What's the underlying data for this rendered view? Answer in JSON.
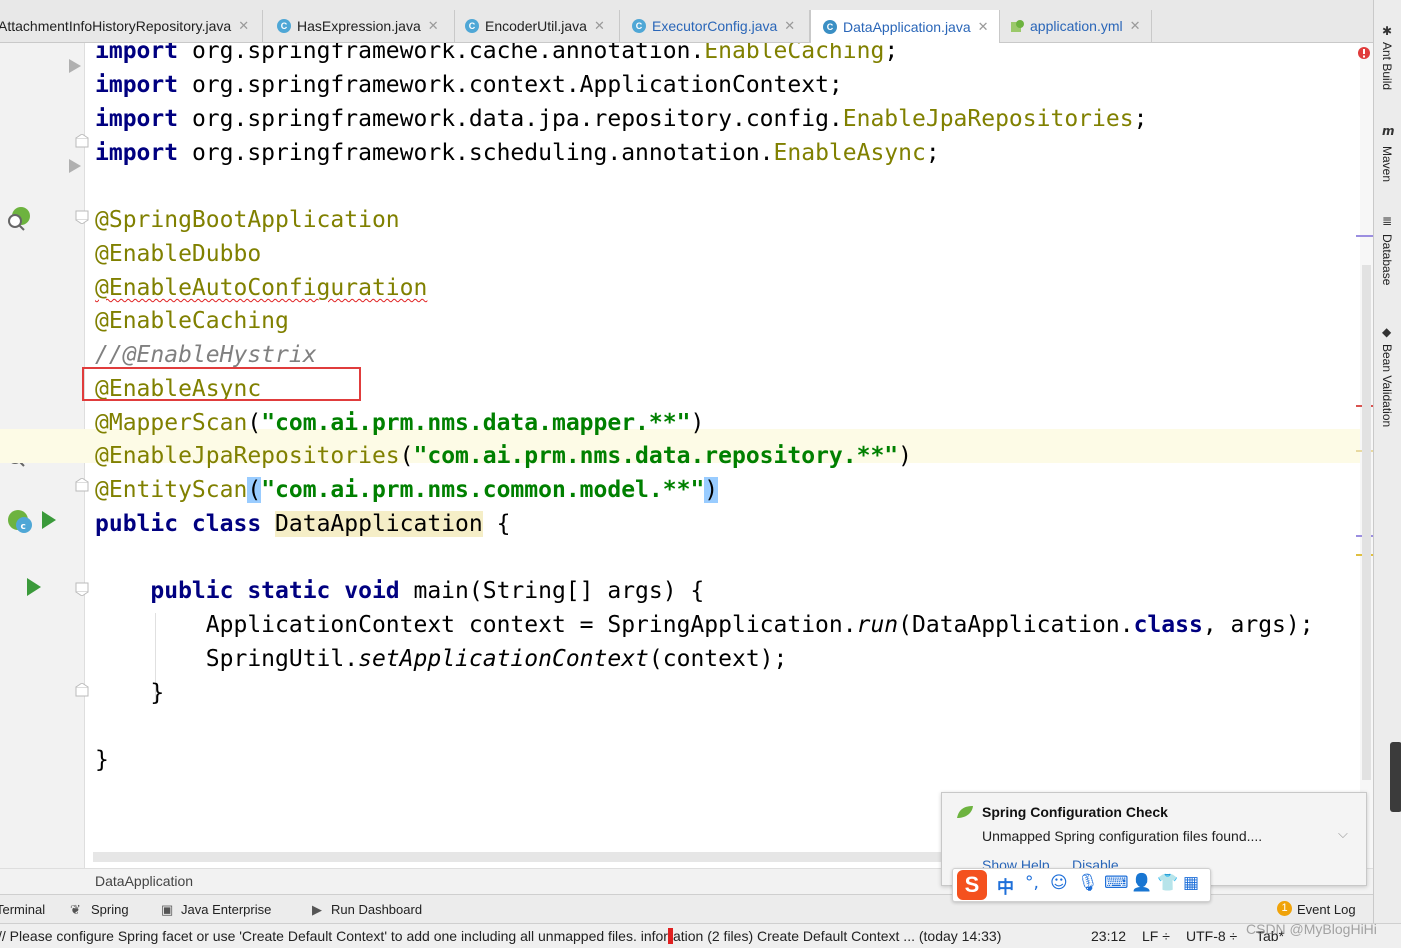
{
  "tabs": [
    {
      "label": "AttachmentInfoHistoryRepository.java",
      "icon": "class-icon",
      "active": false
    },
    {
      "label": "HasExpression.java",
      "icon": "class-icon",
      "active": false
    },
    {
      "label": "EncoderUtil.java",
      "icon": "class-icon",
      "active": false
    },
    {
      "label": "ExecutorConfig.java",
      "icon": "class-icon",
      "active": false
    },
    {
      "label": "DataApplication.java",
      "icon": "spring-class-icon",
      "active": true
    },
    {
      "label": "application.yml",
      "icon": "spring-yaml-icon",
      "active": false
    }
  ],
  "tab_close": "✕",
  "code": {
    "l1": {
      "kw": "import",
      "pkg": " org.springframework.cache.annotation.",
      "cls": "EnableCaching",
      "end": ";"
    },
    "l2": {
      "kw": "import",
      "pkg": " org.springframework.context.ApplicationContext;"
    },
    "l3": {
      "kw": "import",
      "pkg": " org.springframework.data.jpa.repository.config.",
      "cls": "EnableJpaRepositories",
      "end": ";"
    },
    "l4": {
      "kw": "import",
      "pkg": " org.springframework.scheduling.annotation.",
      "cls": "EnableAsync",
      "end": ";"
    },
    "l5": "@SpringBootApplication",
    "l6": "@EnableDubbo",
    "l7": "@EnableAutoConfiguration",
    "l8": "@EnableCaching",
    "l9": "//@EnableHystrix",
    "l10": "@EnableAsync",
    "l11": {
      "ann": "@MapperScan",
      "open": "(",
      "str": "\"com.ai.prm.nms.data.mapper.**\"",
      "close": ")"
    },
    "l12": {
      "ann": "@EnableJpaRepositories",
      "open": "(",
      "str": "\"com.ai.prm.nms.data.repository.**\"",
      "close": ")"
    },
    "l13": {
      "ann": "@EntityScan",
      "open": "(",
      "str": "\"com.ai.prm.nms.common.model.**\"",
      "close": ")"
    },
    "l14": {
      "kw": "public class",
      "sp": " ",
      "name": "DataApplication",
      "rest": " {"
    },
    "l15": {
      "indent": "    ",
      "kw": "public static void",
      "rest": " main(String[] args) {"
    },
    "l16": {
      "indent": "        ",
      "a": "ApplicationContext context = SpringApplication.",
      "method": "run",
      "b": "(DataApplication.",
      "kw": "class",
      "c": ", args);"
    },
    "l17": {
      "indent": "        ",
      "a": "SpringUtil.",
      "method": "setApplicationContext",
      "b": "(context);"
    },
    "l18": "    }",
    "l19": "}"
  },
  "breadcrumb": "DataApplication",
  "tool_windows": [
    {
      "label": "Terminal",
      "icon": "terminal-icon"
    },
    {
      "label": "Spring",
      "icon": "spring-icon"
    },
    {
      "label": "Java Enterprise",
      "icon": "java-enterprise-icon"
    },
    {
      "label": "Run Dashboard",
      "icon": "run-icon"
    }
  ],
  "event_log": {
    "label": "Event Log",
    "count": "1"
  },
  "right_tools": [
    "Ant Build",
    "Maven",
    "Database",
    "Bean Validation"
  ],
  "status": {
    "message_a": "// Please configure Spring facet or use 'Create Default Context' to add one including all unmapped files. infor",
    "message_b": "ation (2 files)   Create Default Context ... (today 14:33)",
    "position": "23:12",
    "line_sep": "LF ÷",
    "encoding": "UTF-8 ÷",
    "indent": "Tab*",
    "watermark": "CSDN @MyBlogHiHi"
  },
  "notification": {
    "title": "Spring Configuration Check",
    "body": "Unmapped Spring configuration files found....",
    "show_help": "Show Help",
    "disable": "Disable..."
  },
  "ime": {
    "logo": "S",
    "lang": "中",
    "punct": "°,"
  },
  "colors": {
    "keyword": "#000080",
    "annotation": "#808000",
    "string": "#008000",
    "highlight_box": "#e03c3c"
  }
}
